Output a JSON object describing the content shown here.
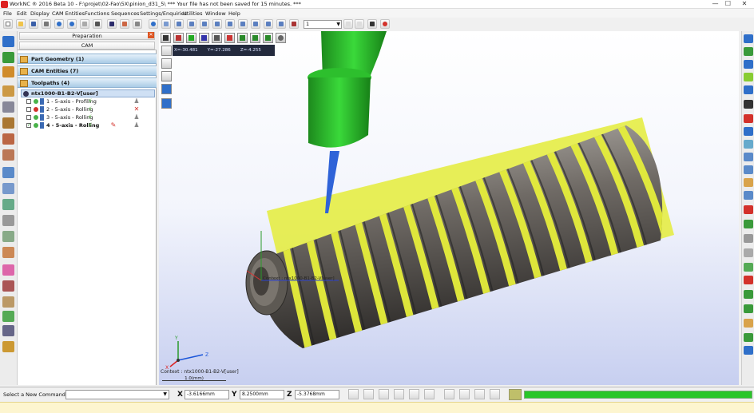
{
  "window": {
    "title": "WorkNC ® 2016 Beta 10 - F:\\projet\\02-Fao\\5X\\pinion_d31_5\\ *** Your file has not been saved for 15 minutes. ***",
    "controls": [
      "—",
      "☐",
      "✕"
    ]
  },
  "menu": [
    "File",
    "Edit",
    "Display",
    "CAM Entities",
    "Functions",
    "Sequences",
    "Settings/Enquiries",
    "Utilities",
    "Window",
    "Help"
  ],
  "toolbar": {
    "layer_value": "1",
    "colors": {
      "accent": "#2f6fc9",
      "green": "#3caa2a",
      "red": "#d3312a",
      "yellow": "#f0c44a"
    }
  },
  "panel": {
    "tab_preparation": "Preparation",
    "tab_cam": "CAM",
    "close": "✕",
    "sections": [
      {
        "label": "Part Geometry (1)"
      },
      {
        "label": "CAM Entities (7)"
      },
      {
        "label": "Toolpaths (4)"
      }
    ],
    "root": "ntx1000-B1-B2-V[user]",
    "toolpaths": [
      {
        "label": "1 - 5-axis - Profiling",
        "checked": false,
        "status": "pending"
      },
      {
        "label": "2 - 5-axis - Rolling",
        "checked": false,
        "status": "error"
      },
      {
        "label": "3 - 5-axis - Rolling",
        "checked": false,
        "status": "pending"
      },
      {
        "label": "4 - 5-axis - Rolling",
        "checked": true,
        "status": "edit"
      }
    ]
  },
  "viewport": {
    "coords": {
      "x": "X=-30.481",
      "y": "Y=-27.286",
      "z": "Z=-4.255"
    },
    "tool_label": "Context : ntx1000-B1-B2-V[user]",
    "context": "Context : ntx1000-B1-B2-V[user]",
    "scale": "1.0(mm)",
    "axis_x": "X",
    "axis_y": "Y",
    "axis_z": "Z"
  },
  "status": {
    "command_label": "Select a New Command...",
    "x_label": "X",
    "x_value": "-3.6166mm",
    "y_label": "Y",
    "y_value": "8.2500mm",
    "z_label": "Z",
    "z_value": "-5.3768mm",
    "progress": 1.0
  }
}
